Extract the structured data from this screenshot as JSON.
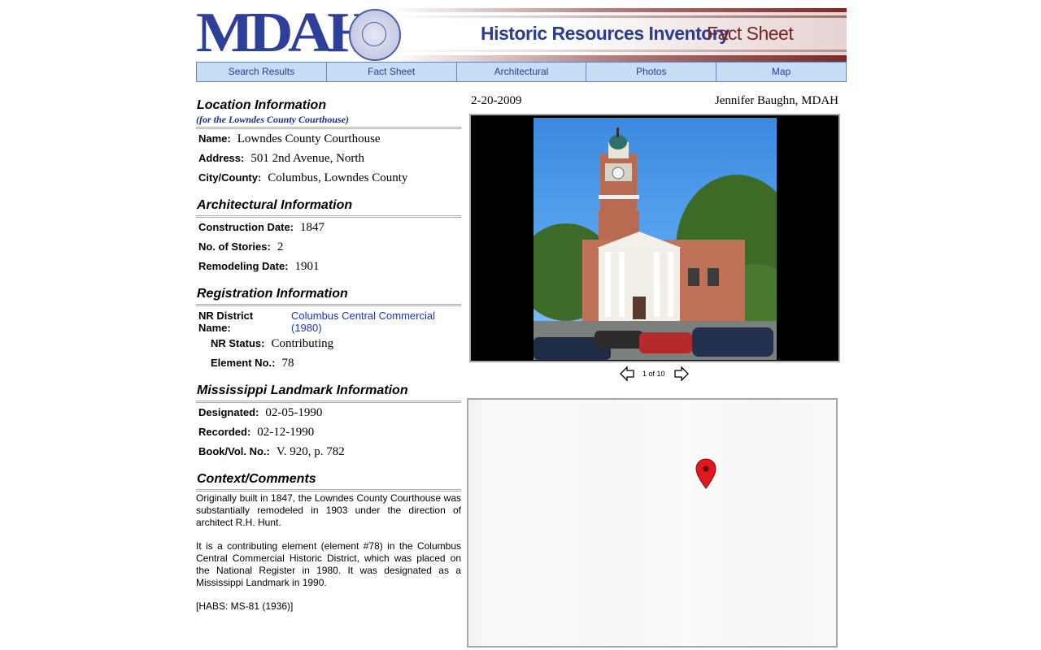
{
  "header": {
    "logo_text": "MDAH",
    "title": "Historic Resources Inventory",
    "subtitle": "Fact Sheet"
  },
  "nav": {
    "tabs": [
      "Search Results",
      "Fact Sheet",
      "Architectural",
      "Photos",
      "Map"
    ]
  },
  "location": {
    "heading": "Location Information",
    "subheading": "(for the Lowndes County Courthouse)",
    "name_label": "Name:",
    "name": "Lowndes County Courthouse",
    "address_label": "Address:",
    "address": "501 2nd Avenue, North",
    "city_label": "City/County:",
    "city": "Columbus, Lowndes County"
  },
  "architectural": {
    "heading": "Architectural Information",
    "construction_label": "Construction Date:",
    "construction": "1847",
    "stories_label": "No. of Stories:",
    "stories": "2",
    "remodel_label": "Remodeling Date:",
    "remodel": "1901"
  },
  "registration": {
    "heading": "Registration Information",
    "district_label": "NR District Name:",
    "district": "Columbus Central Commercial (1980)",
    "status_label": "NR Status:",
    "status": "Contributing",
    "element_label": "Element No.:",
    "element": "78"
  },
  "landmark": {
    "heading": "Mississippi Landmark Information",
    "designated_label": "Designated:",
    "designated": "02-05-1990",
    "recorded_label": "Recorded:",
    "recorded": "02-12-1990",
    "book_label": "Book/Vol. No.:",
    "book": "V. 920, p. 782"
  },
  "context": {
    "heading": "Context/Comments",
    "p1": "Originally built in 1847, the Lowndes County Courthouse was substantially remodeled in 1903 under the direction of architect R.H. Hunt.",
    "p2": "It is a contributing element (element #78) in the Columbus Central Commercial Historic District, which was placed on the National Register in 1980. It was designated as a Mississippi Landmark in 1990.",
    "p3": "[HABS: MS-81 (1936)]"
  },
  "photo": {
    "date": "2-20-2009",
    "credit": "Jennifer Baughn, MDAH",
    "counter": "1 of 10"
  },
  "colors": {
    "brand_blue": "#2d3f99",
    "brand_red": "#7a2424",
    "nav_bg": "#c7dcf5",
    "link": "#1f33c5",
    "pin": "#e0191e"
  }
}
